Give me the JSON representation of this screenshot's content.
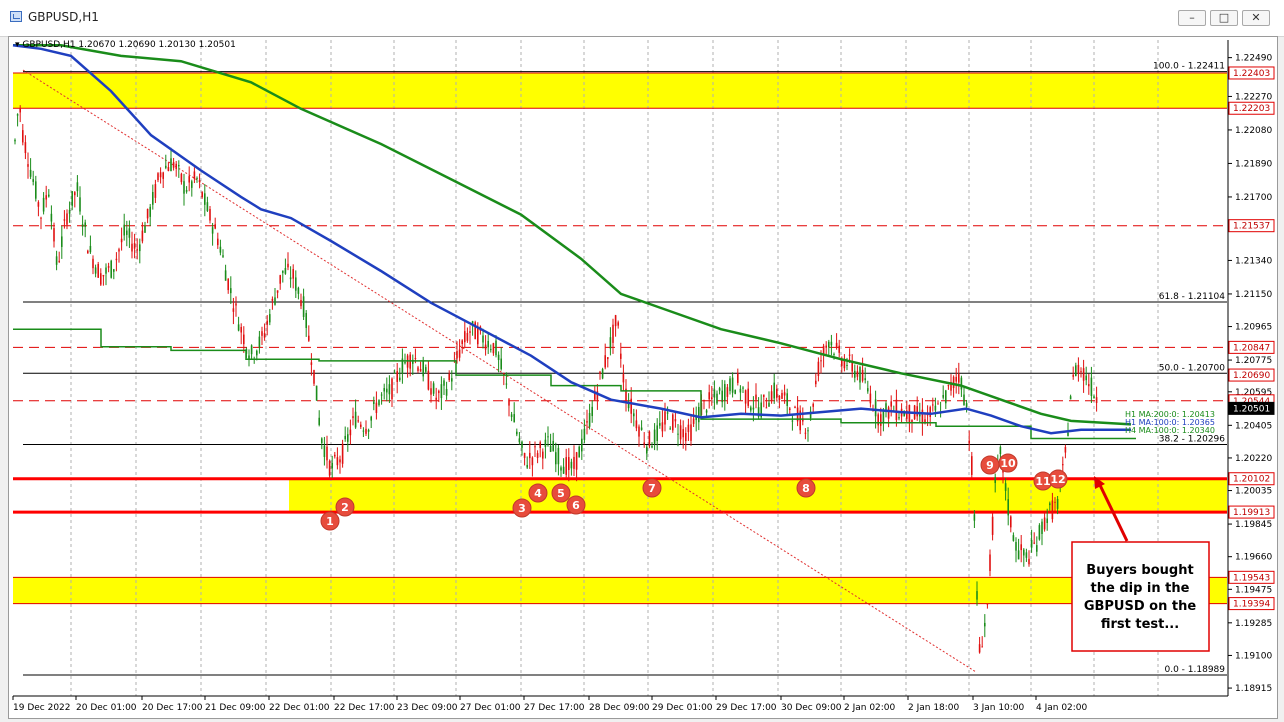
{
  "window": {
    "title": "GBPUSD,H1"
  },
  "chart_data": {
    "type": "candlestick",
    "symbol_header": "GBPUSD,H1  1.20670 1.20690 1.20130 1.20501",
    "y_ticks": [
      1.2249,
      1.2227,
      1.2208,
      1.2189,
      1.217,
      1.2153,
      1.2134,
      1.2115,
      1.20965,
      1.20775,
      1.20595,
      1.20405,
      1.2022,
      1.20035,
      1.19845,
      1.1966,
      1.19475,
      1.19285,
      1.191,
      1.18915
    ],
    "y_tick_labels": [
      "1.22490",
      "1.22270",
      "1.22080",
      "1.21890",
      "1.21700",
      "1.21530",
      "1.21340",
      "1.21150",
      "1.20965",
      "1.20775",
      "1.20595",
      "1.20405",
      "1.20220",
      "1.20035",
      "1.19845",
      "1.19660",
      "1.19475",
      "1.19285",
      "1.19100",
      "1.18915"
    ],
    "ylim": [
      1.1887,
      1.2259
    ],
    "x_labels": [
      "19 Dec 2022",
      "20 Dec 01:00",
      "20 Dec 17:00",
      "21 Dec 09:00",
      "22 Dec 01:00",
      "22 Dec 17:00",
      "23 Dec 09:00",
      "27 Dec 01:00",
      "27 Dec 17:00",
      "28 Dec 09:00",
      "29 Dec 01:00",
      "29 Dec 17:00",
      "30 Dec 09:00",
      "2 Jan 02:00",
      "2 Jan 18:00",
      "3 Jan 10:00",
      "4 Jan 02:00"
    ],
    "price_labels": [
      {
        "value": 1.22403,
        "text": "1.22403",
        "color": "#ff0000"
      },
      {
        "value": 1.22203,
        "text": "1.22203",
        "color": "#ff0000"
      },
      {
        "value": 1.21537,
        "text": "1.21537",
        "color": "#ff0000"
      },
      {
        "value": 1.20847,
        "text": "1.20847",
        "color": "#ff0000"
      },
      {
        "value": 1.2069,
        "text": "1.20690",
        "color": "#ff0000"
      },
      {
        "value": 1.20544,
        "text": "1.20544",
        "color": "#ff0000"
      },
      {
        "value": 1.20501,
        "text": "1.20501",
        "color": "#ffffff",
        "bg": "#000000"
      },
      {
        "value": 1.20102,
        "text": "1.20102",
        "color": "#ff0000"
      },
      {
        "value": 1.19913,
        "text": "1.19913",
        "color": "#ff0000"
      },
      {
        "value": 1.19543,
        "text": "1.19543",
        "color": "#ff0000"
      },
      {
        "value": 1.19394,
        "text": "1.19394",
        "color": "#ff0000"
      }
    ],
    "fib_labels": [
      {
        "value": 1.22411,
        "text": "100.0 - 1.22411"
      },
      {
        "value": 1.21104,
        "text": "61.8 - 1.21104"
      },
      {
        "value": 1.207,
        "text": "50.0 - 1.20700"
      },
      {
        "value": 1.20296,
        "text": "38.2 - 1.20296"
      },
      {
        "value": 1.18989,
        "text": "0.0 - 1.18989"
      }
    ],
    "ma_labels": [
      {
        "text": "H1 MA:200:0: 1.20413",
        "color": "#1a8c1a"
      },
      {
        "text": "H1 MA:100:0: 1.20365",
        "color": "#1f3fbf"
      },
      {
        "text": "H4 MA:100:0: 1.20340",
        "color": "#1a8c1a"
      }
    ],
    "zones": [
      {
        "from": 1.22203,
        "to": 1.22403,
        "color": "#ffff00"
      },
      {
        "from": 1.19913,
        "to": 1.20102,
        "color": "#ffff00"
      },
      {
        "from": 1.19394,
        "to": 1.19543,
        "color": "#ffff00"
      }
    ],
    "support_lines": [
      1.20102,
      1.19913
    ],
    "dashed_lines": [
      1.21537,
      1.20847,
      1.20544
    ],
    "markers": [
      "1",
      "2",
      "3",
      "4",
      "5",
      "6",
      "7",
      "8",
      "9",
      "10",
      "11",
      "12"
    ],
    "annotation": "Buyers bought the dip in the GBPUSD on the first test...",
    "series": [
      {
        "name": "H1 MA:100",
        "color": "#1f3fbf"
      },
      {
        "name": "H1 MA:200",
        "color": "#1a8c1a"
      },
      {
        "name": "H4 MA:100",
        "color": "#1a8c1a"
      }
    ]
  }
}
